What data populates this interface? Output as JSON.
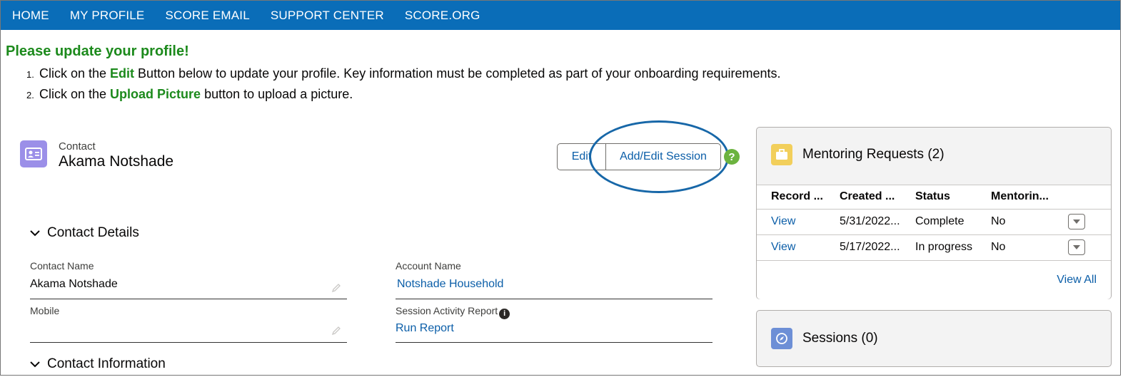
{
  "nav": {
    "items": [
      "HOME",
      "MY PROFILE",
      "SCORE EMAIL",
      "SUPPORT CENTER",
      "SCORE.ORG"
    ]
  },
  "notice": {
    "title": "Please update your profile!",
    "steps": [
      {
        "num": "1.",
        "pre": "Click on the ",
        "bold": "Edit",
        "post": " Button below to update your profile. Key information must be completed as part of your onboarding requirements."
      },
      {
        "num": "2.",
        "pre": "Click on the ",
        "bold": "Upload Picture",
        "post": " button to upload a picture."
      }
    ]
  },
  "record": {
    "type": "Contact",
    "name": "Akama Notshade",
    "edit_label": "Edit",
    "session_label": "Add/Edit Session",
    "help_glyph": "?"
  },
  "details": {
    "section1": "Contact Details",
    "section2": "Contact Information",
    "contact_name_label": "Contact Name",
    "contact_name_value": "Akama Notshade",
    "mobile_label": "Mobile",
    "mobile_value": "",
    "account_name_label": "Account Name",
    "account_name_value": "Notshade Household",
    "report_label": "Session Activity Report",
    "report_link": "Run Report"
  },
  "mentoring": {
    "title": "Mentoring Requests (2)",
    "columns": [
      "Record ...",
      "Created ...",
      "Status",
      "Mentorin..."
    ],
    "rows": [
      {
        "record": "View",
        "created": "5/31/2022...",
        "status": "Complete",
        "mentoring": "No"
      },
      {
        "record": "View",
        "created": "5/17/2022...",
        "status": "In progress",
        "mentoring": "No"
      }
    ],
    "view_all": "View All"
  },
  "sessions": {
    "title": "Sessions (0)"
  },
  "colors": {
    "nav_bg": "#0a6db8",
    "notice_green": "#1c8a1c",
    "link_blue": "#0b5ea8",
    "contact_icon": "#9b8fe8",
    "mentoring_icon": "#f2cf5b",
    "sessions_icon": "#6d8fd6"
  }
}
